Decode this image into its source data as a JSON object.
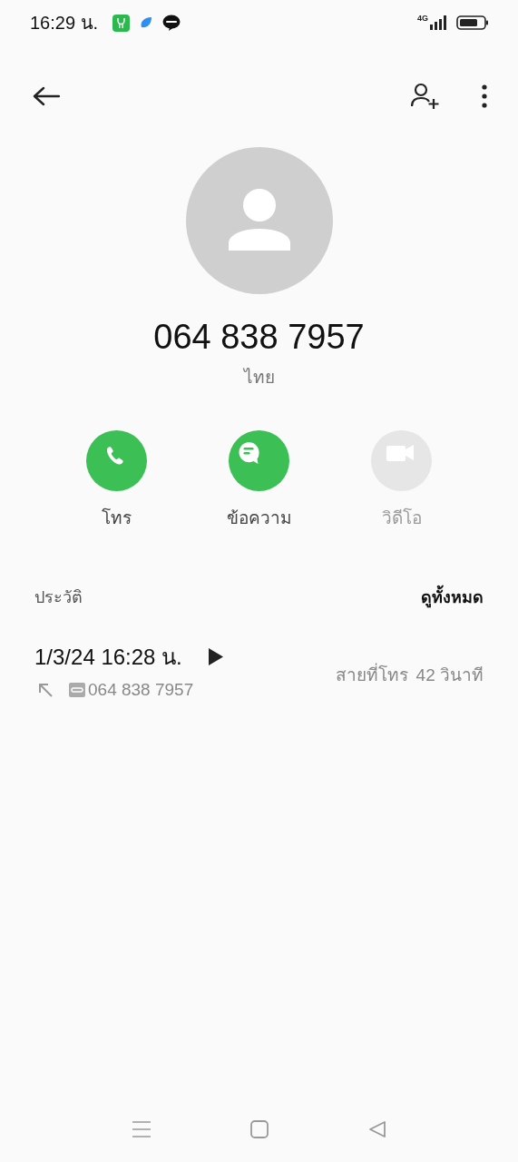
{
  "status_bar": {
    "time": "16:29 น.",
    "network": "4G"
  },
  "contact": {
    "number": "064 838 7957",
    "location": "ไทย"
  },
  "actions": [
    {
      "kind": "call",
      "label": "โทร",
      "disabled": false
    },
    {
      "kind": "message",
      "label": "ข้อความ",
      "disabled": false
    },
    {
      "kind": "video",
      "label": "วิดีโอ",
      "disabled": true
    }
  ],
  "history": {
    "title": "ประวัติ",
    "see_all": "ดูทั้งหมด",
    "entries": [
      {
        "datetime": "1/3/24 16:28 น.",
        "number": "064 838 7957",
        "type": "สายที่โทร",
        "duration": "42 วินาที"
      }
    ]
  }
}
